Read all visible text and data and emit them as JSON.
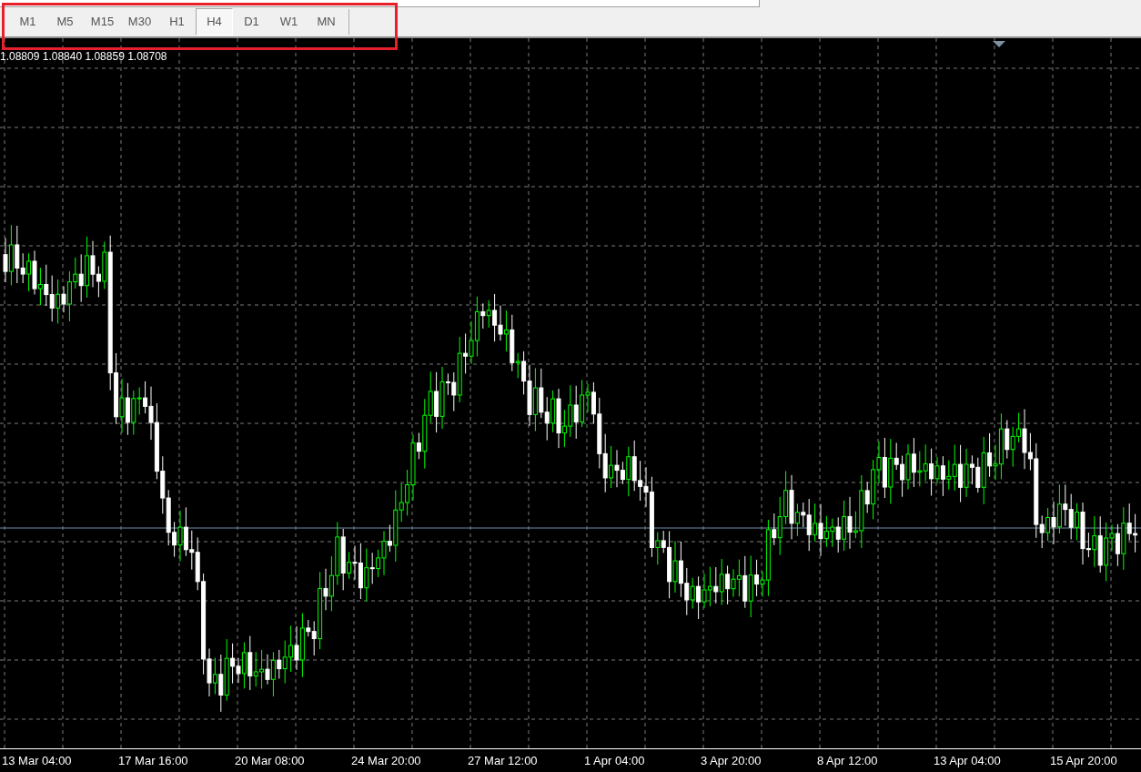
{
  "toolbar": {
    "timeframes": [
      {
        "label": "M1",
        "selected": false
      },
      {
        "label": "M5",
        "selected": false
      },
      {
        "label": "M15",
        "selected": false
      },
      {
        "label": "M30",
        "selected": false
      },
      {
        "label": "H1",
        "selected": false
      },
      {
        "label": "H4",
        "selected": true
      },
      {
        "label": "D1",
        "selected": false
      },
      {
        "label": "W1",
        "selected": false
      },
      {
        "label": "MN",
        "selected": false
      }
    ]
  },
  "chart": {
    "ohlc_text": "1.08809 1.08840 1.08859 1.08708"
  },
  "time_axis": [
    "13 Mar 04:00",
    "17 Mar 16:00",
    "20 Mar 08:00",
    "24 Mar 20:00",
    "27 Mar 12:00",
    "1 Apr 04:00",
    "3 Apr 20:00",
    "8 Apr 12:00",
    "13 Apr 04:00",
    "15 Apr 20:00"
  ]
}
